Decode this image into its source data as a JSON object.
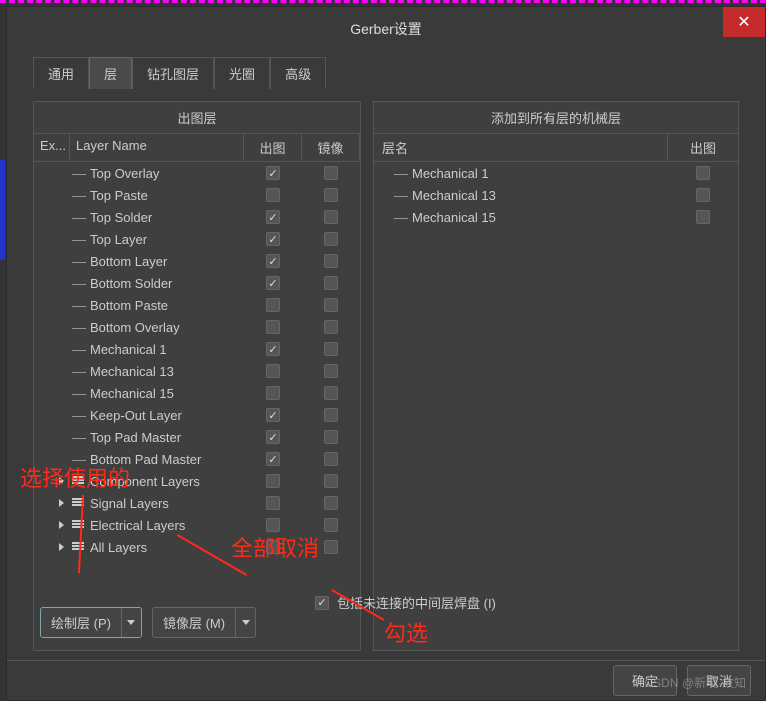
{
  "title": "Gerber设置",
  "tabs": [
    "通用",
    "层",
    "钻孔图层",
    "光圈",
    "高级"
  ],
  "activeTab": 1,
  "leftPanel": {
    "title": "出图层",
    "headers": {
      "ex": "Ex...",
      "name": "Layer Name",
      "plot": "出图",
      "mirror": "镜像"
    },
    "rows": [
      {
        "name": "Top Overlay",
        "plot": true,
        "mirror": false,
        "type": "leaf"
      },
      {
        "name": "Top Paste",
        "plot": false,
        "mirror": false,
        "type": "leaf"
      },
      {
        "name": "Top Solder",
        "plot": true,
        "mirror": false,
        "type": "leaf"
      },
      {
        "name": "Top Layer",
        "plot": true,
        "mirror": false,
        "type": "leaf"
      },
      {
        "name": "Bottom Layer",
        "plot": true,
        "mirror": false,
        "type": "leaf"
      },
      {
        "name": "Bottom Solder",
        "plot": true,
        "mirror": false,
        "type": "leaf"
      },
      {
        "name": "Bottom Paste",
        "plot": false,
        "mirror": false,
        "type": "leaf"
      },
      {
        "name": "Bottom Overlay",
        "plot": false,
        "mirror": false,
        "type": "leaf"
      },
      {
        "name": "Mechanical 1",
        "plot": true,
        "mirror": false,
        "type": "leaf"
      },
      {
        "name": "Mechanical 13",
        "plot": false,
        "mirror": false,
        "type": "leaf"
      },
      {
        "name": "Mechanical 15",
        "plot": false,
        "mirror": false,
        "type": "leaf"
      },
      {
        "name": "Keep-Out Layer",
        "plot": true,
        "mirror": false,
        "type": "leaf"
      },
      {
        "name": "Top Pad Master",
        "plot": true,
        "mirror": false,
        "type": "leaf"
      },
      {
        "name": "Bottom Pad Master",
        "plot": true,
        "mirror": false,
        "type": "leaf"
      },
      {
        "name": "Component Layers",
        "plot": false,
        "mirror": false,
        "type": "group"
      },
      {
        "name": "Signal Layers",
        "plot": false,
        "mirror": false,
        "type": "group"
      },
      {
        "name": "Electrical Layers",
        "plot": false,
        "mirror": false,
        "type": "group"
      },
      {
        "name": "All Layers",
        "plot": false,
        "mirror": false,
        "type": "group"
      }
    ]
  },
  "rightPanel": {
    "title": "添加到所有层的机械层",
    "headers": {
      "name": "层名",
      "plot": "出图"
    },
    "rows": [
      {
        "name": "Mechanical 1",
        "plot": false
      },
      {
        "name": "Mechanical 13",
        "plot": false
      },
      {
        "name": "Mechanical 15",
        "plot": false
      }
    ]
  },
  "bottom": {
    "drawBtn": "绘制层 (P)",
    "mirrorBtn": "镜像层 (M)",
    "includeLabel": "包括未连接的中间层焊盘 (I)",
    "includeChecked": true
  },
  "footer": {
    "ok": "确定",
    "cancel": "取消"
  },
  "annotations": {
    "a1": "选择使用的",
    "a2": "全部取消",
    "a3": "勾选"
  },
  "watermark": "CSDN @新晓·故知"
}
